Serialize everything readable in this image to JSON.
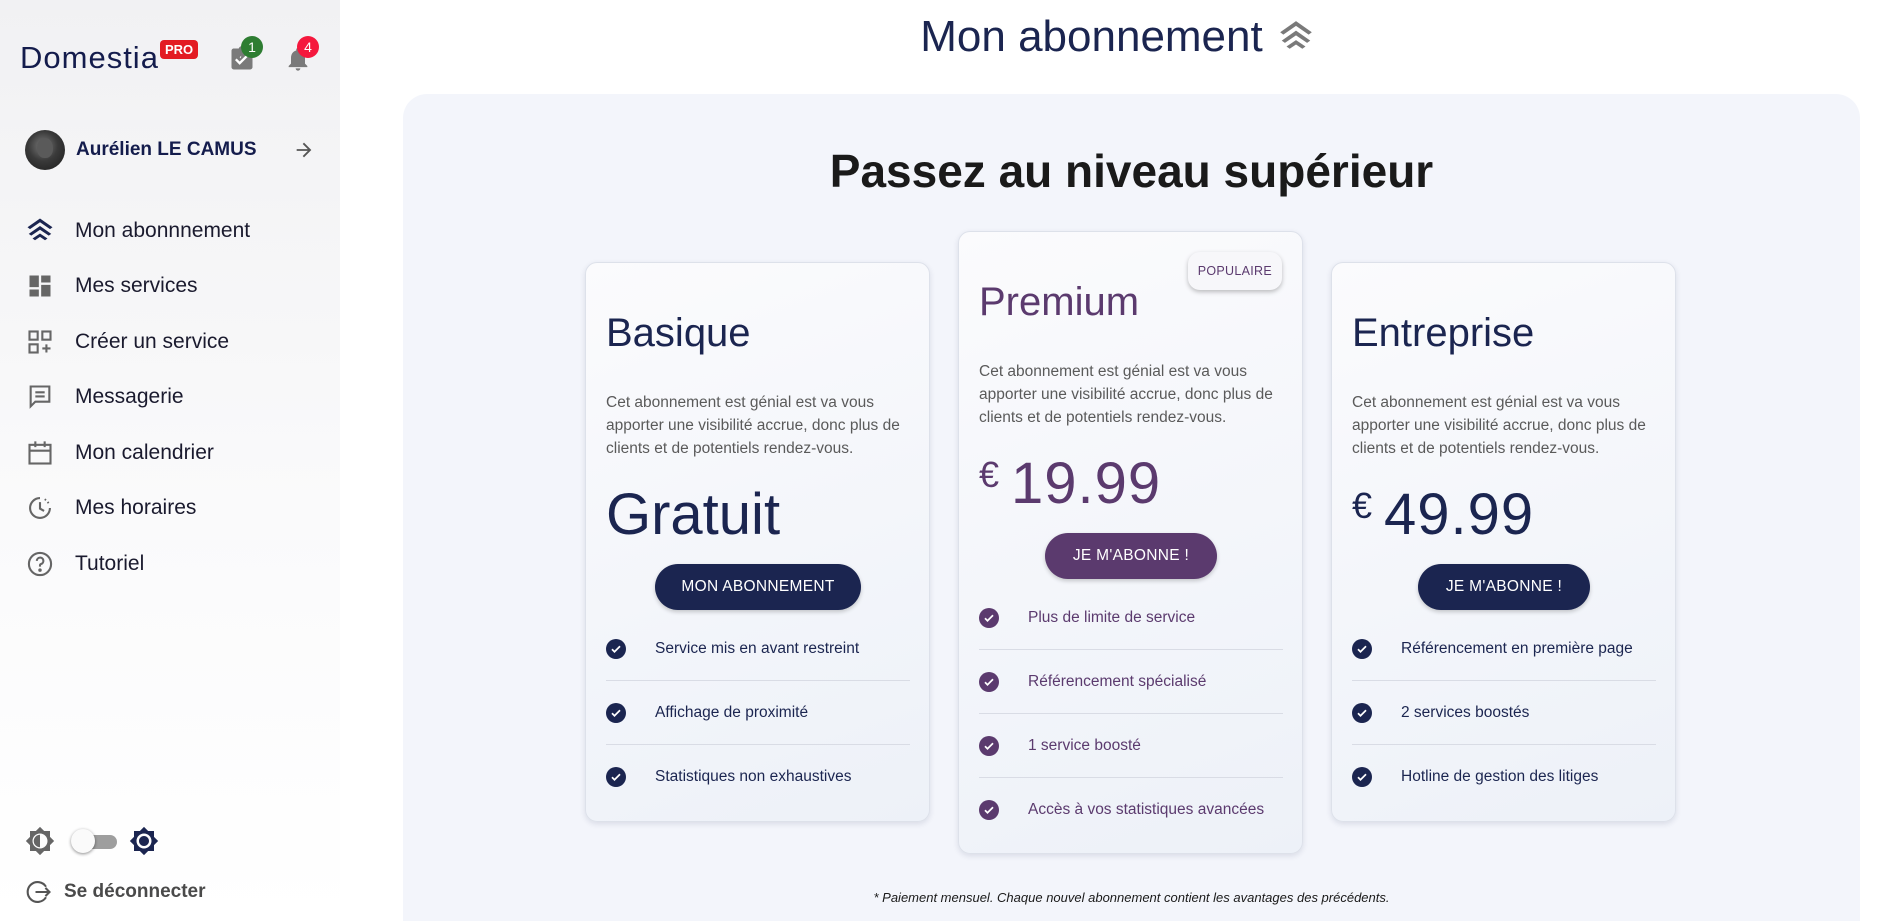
{
  "brand": {
    "name": "Domestia",
    "badge": "PRO"
  },
  "notifications": {
    "tasks_count": "1",
    "alerts_count": "4"
  },
  "user": {
    "name": "Aurélien LE CAMUS"
  },
  "nav": {
    "items": [
      {
        "label": "Mon abonnnement",
        "icon": "subscription-chevrons-icon"
      },
      {
        "label": "Mes services",
        "icon": "dashboard-icon"
      },
      {
        "label": "Créer un service",
        "icon": "add-grid-icon"
      },
      {
        "label": "Messagerie",
        "icon": "message-icon"
      },
      {
        "label": "Mon calendrier",
        "icon": "calendar-icon"
      },
      {
        "label": "Mes horaires",
        "icon": "schedule-icon"
      },
      {
        "label": "Tutoriel",
        "icon": "help-icon"
      }
    ]
  },
  "footer": {
    "logout_label": "Se déconnecter"
  },
  "page": {
    "title": "Mon abonnement",
    "heading": "Passez au niveau supérieur"
  },
  "plans": [
    {
      "name": "Basique",
      "description": "Cet abonnement est génial est va vous apporter une visibilité accrue, donc plus de clients et de potentiels rendez-vous.",
      "price": "Gratuit",
      "cta": "MON ABONNEMENT",
      "features": [
        "Service mis en avant restreint",
        "Affichage de proximité",
        "Statistiques non exhaustives"
      ]
    },
    {
      "name": "Premium",
      "badge": "POPULAIRE",
      "description": "Cet abonnement est génial est va vous apporter une visibilité accrue, donc plus de clients et de potentiels rendez-vous.",
      "currency": "€",
      "price": "19.99",
      "cta": "JE M'ABONNE !",
      "features": [
        "Plus de limite de service",
        "Référencement spécialisé",
        "1 service boosté",
        "Accès à vos statistiques avancées"
      ]
    },
    {
      "name": "Entreprise",
      "description": "Cet abonnement est génial est va vous apporter une visibilité accrue, donc plus de clients et de potentiels rendez-vous.",
      "currency": "€",
      "price": "49.99",
      "cta": "JE M'ABONNE !",
      "features": [
        "Référencement en première page",
        "2 services boostés",
        "Hotline de gestion des litiges"
      ]
    }
  ],
  "footnote": "* Paiement mensuel. Chaque nouvel abonnement contient les avantages des précédents.",
  "colors": {
    "navy": "#1b2550",
    "purple": "#5b3a6e",
    "pro_red": "#e31b23",
    "panel_bg": "#f3f5fb"
  }
}
